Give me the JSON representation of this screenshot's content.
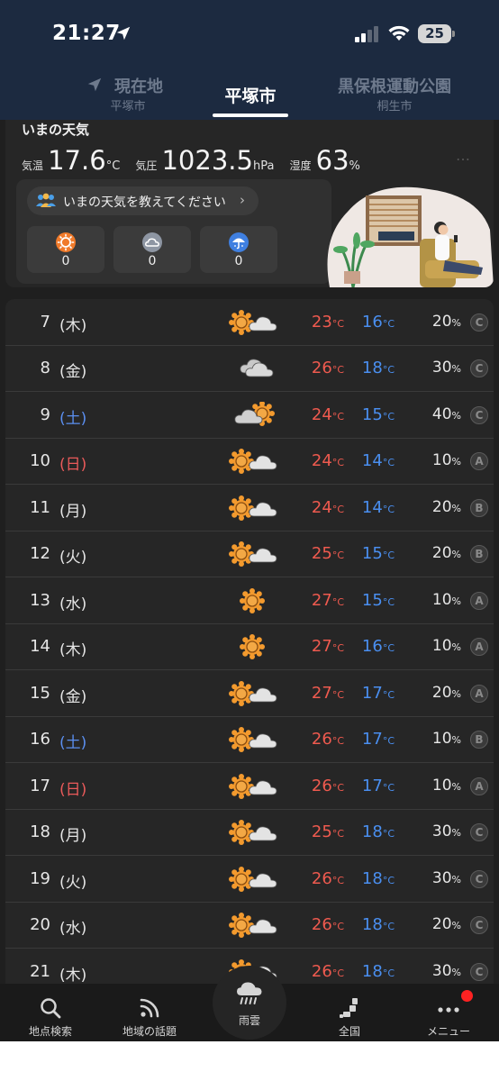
{
  "status_bar": {
    "time": "21:27",
    "battery": "25"
  },
  "tabs": [
    {
      "name": "現在地",
      "sub": "平塚市"
    },
    {
      "name": "平塚市",
      "sub": ""
    },
    {
      "name": "黒保根運動公園",
      "sub": "桐生市"
    }
  ],
  "now": {
    "title": "いまの天気",
    "temp_label": "気温",
    "temp_value": "17.6",
    "temp_unit": "°C",
    "pressure_label": "気圧",
    "pressure_value": "1023.5",
    "pressure_unit": "hPa",
    "humidity_label": "湿度",
    "humidity_value": "63",
    "humidity_unit": "%",
    "more": "…",
    "report_prompt": "いまの天気を教えてください",
    "report_chevron": "›",
    "reports": [
      {
        "icon": "sun-icon",
        "count": "0"
      },
      {
        "icon": "cloud-icon",
        "count": "0"
      },
      {
        "icon": "umbrella-icon",
        "count": "0"
      }
    ]
  },
  "forecast_unit_temp": "°C",
  "forecast_unit_pop": "%",
  "forecast": [
    {
      "day": "7",
      "dow": "(木)",
      "weekend": "",
      "icon": "sun-cloud-icon",
      "hi": "23",
      "lo": "16",
      "pop": "20",
      "grade": "C"
    },
    {
      "day": "8",
      "dow": "(金)",
      "weekend": "",
      "icon": "cloud-icon",
      "hi": "26",
      "lo": "18",
      "pop": "30",
      "grade": "C"
    },
    {
      "day": "9",
      "dow": "(土)",
      "weekend": "sat",
      "icon": "cloud-sun-icon",
      "hi": "24",
      "lo": "15",
      "pop": "40",
      "grade": "C"
    },
    {
      "day": "10",
      "dow": "(日)",
      "weekend": "sun",
      "icon": "sun-cloud-icon",
      "hi": "24",
      "lo": "14",
      "pop": "10",
      "grade": "A"
    },
    {
      "day": "11",
      "dow": "(月)",
      "weekend": "",
      "icon": "sun-cloud-icon",
      "hi": "24",
      "lo": "14",
      "pop": "20",
      "grade": "B"
    },
    {
      "day": "12",
      "dow": "(火)",
      "weekend": "",
      "icon": "sun-cloud-icon",
      "hi": "25",
      "lo": "15",
      "pop": "20",
      "grade": "B"
    },
    {
      "day": "13",
      "dow": "(水)",
      "weekend": "",
      "icon": "sun-icon",
      "hi": "27",
      "lo": "15",
      "pop": "10",
      "grade": "A"
    },
    {
      "day": "14",
      "dow": "(木)",
      "weekend": "",
      "icon": "sun-icon",
      "hi": "27",
      "lo": "16",
      "pop": "10",
      "grade": "A"
    },
    {
      "day": "15",
      "dow": "(金)",
      "weekend": "",
      "icon": "sun-cloud-icon",
      "hi": "27",
      "lo": "17",
      "pop": "20",
      "grade": "A"
    },
    {
      "day": "16",
      "dow": "(土)",
      "weekend": "sat",
      "icon": "sun-cloud-icon",
      "hi": "26",
      "lo": "17",
      "pop": "10",
      "grade": "B"
    },
    {
      "day": "17",
      "dow": "(日)",
      "weekend": "sun",
      "icon": "sun-cloud-icon",
      "hi": "26",
      "lo": "17",
      "pop": "10",
      "grade": "A"
    },
    {
      "day": "18",
      "dow": "(月)",
      "weekend": "",
      "icon": "sun-cloud-icon",
      "hi": "25",
      "lo": "18",
      "pop": "30",
      "grade": "C"
    },
    {
      "day": "19",
      "dow": "(火)",
      "weekend": "",
      "icon": "sun-cloud-icon",
      "hi": "26",
      "lo": "18",
      "pop": "30",
      "grade": "C"
    },
    {
      "day": "20",
      "dow": "(水)",
      "weekend": "",
      "icon": "sun-cloud-icon",
      "hi": "26",
      "lo": "18",
      "pop": "20",
      "grade": "C"
    },
    {
      "day": "21",
      "dow": "(木)",
      "weekend": "",
      "icon": "sun-cloud-icon",
      "hi": "26",
      "lo": "18",
      "pop": "30",
      "grade": "C"
    }
  ],
  "bottom_nav": [
    {
      "label": "地点検索",
      "icon": "search-icon"
    },
    {
      "label": "地域の話題",
      "icon": "rss-icon"
    },
    {
      "label": "雨雲",
      "icon": "rain-cloud-icon"
    },
    {
      "label": "全国",
      "icon": "japan-map-icon"
    },
    {
      "label": "メニュー",
      "icon": "more-icon"
    }
  ],
  "colors": {
    "high": "#ef5a4f",
    "low": "#4a8ff0",
    "sat": "#5b8ff0",
    "sun": "#ea5a5a",
    "header": "#1c2a40",
    "accent_orange": "#f39a2e"
  }
}
